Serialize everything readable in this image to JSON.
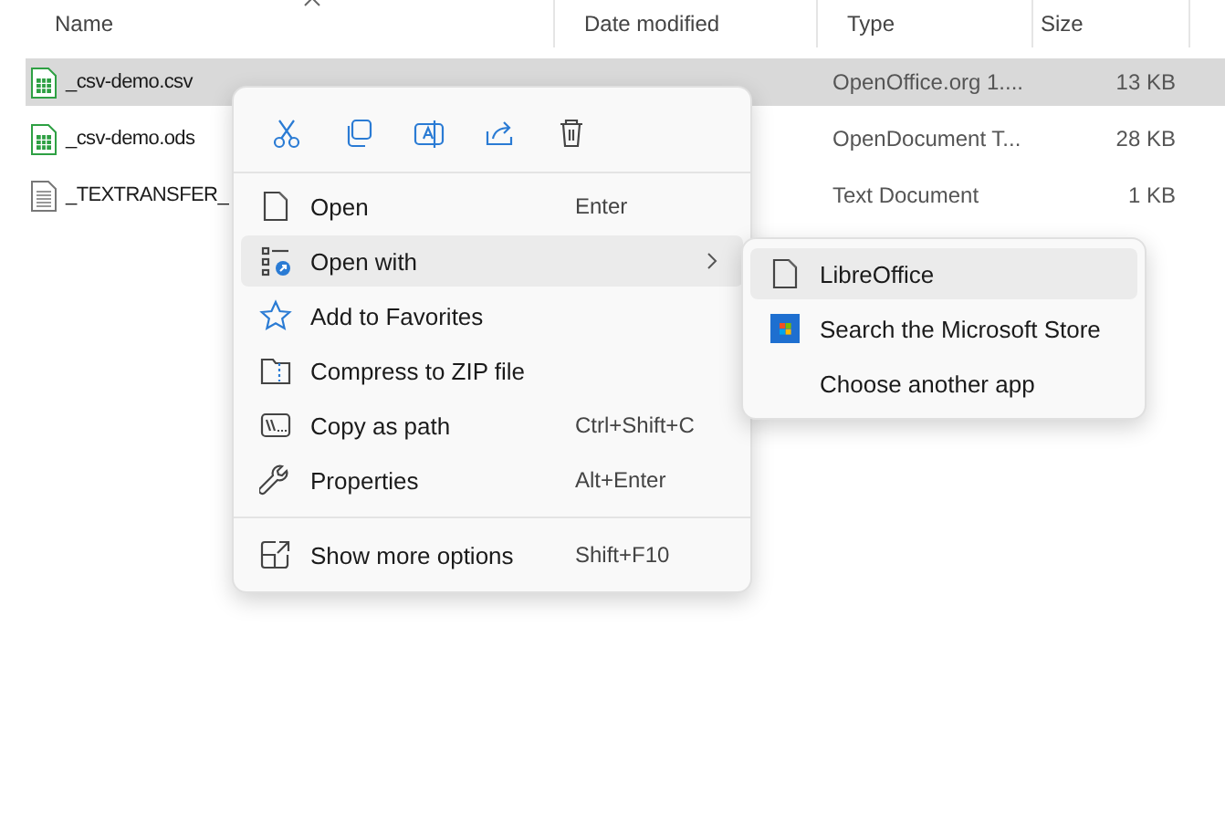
{
  "columns": [
    {
      "label": "Name",
      "sorted": true
    },
    {
      "label": "Date modified"
    },
    {
      "label": "Type"
    },
    {
      "label": "Size"
    }
  ],
  "files": [
    {
      "kind": "sheet",
      "name": "_csv-demo.csv",
      "type": "OpenOffice.org 1....",
      "size": "13 KB",
      "selected": true
    },
    {
      "kind": "sheet",
      "name": "_csv-demo.ods",
      "type": "OpenDocument T...",
      "size": "28 KB",
      "selected": false
    },
    {
      "kind": "text",
      "name": "_TEXTRANSFER_",
      "type": "Text Document",
      "size": "1 KB",
      "selected": false
    }
  ],
  "context_menu": {
    "toolbar": [
      {
        "kind": "cut"
      },
      {
        "kind": "copy"
      },
      {
        "kind": "rename"
      },
      {
        "kind": "share"
      },
      {
        "kind": "delete"
      }
    ],
    "items": [
      {
        "kind": "open",
        "label": "Open",
        "shortcut": "Enter",
        "selected": false
      },
      {
        "kind": "openwith",
        "label": "Open with",
        "submenu": true,
        "selected": true
      },
      {
        "kind": "star",
        "label": "Add to Favorites",
        "selected": false
      },
      {
        "kind": "zip",
        "label": "Compress to ZIP file",
        "selected": false
      },
      {
        "kind": "path",
        "label": "Copy as path",
        "shortcut": "Ctrl+Shift+C",
        "selected": false
      },
      {
        "kind": "wrench",
        "label": "Properties",
        "shortcut": "Alt+Enter",
        "selected": false
      },
      {
        "kind": "more",
        "label": "Show more options",
        "shortcut": "Shift+F10",
        "separator": true,
        "selected": false
      }
    ]
  },
  "submenu": {
    "items": [
      {
        "kind": "doc",
        "label": "LibreOffice",
        "selected": true
      },
      {
        "kind": "store",
        "label": "Search the Microsoft Store",
        "selected": false
      },
      {
        "kind": "none",
        "label": "Choose another app",
        "selected": false
      }
    ]
  }
}
